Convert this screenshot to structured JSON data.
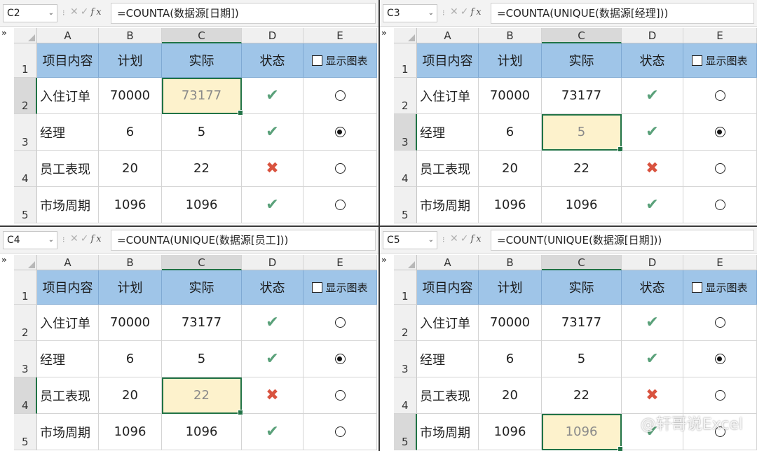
{
  "columns": [
    "A",
    "B",
    "C",
    "D",
    "E"
  ],
  "rows": [
    "1",
    "2",
    "3",
    "4",
    "5"
  ],
  "header": {
    "item": "项目内容",
    "plan": "计划",
    "actual": "实际",
    "status": "状态",
    "show_chart": "显示图表"
  },
  "data_rows": [
    {
      "item": "入住订单",
      "plan": "70000",
      "actual": "73177",
      "status": "check",
      "radio": false
    },
    {
      "item": "经理",
      "plan": "6",
      "actual": "5",
      "status": "check",
      "radio": true
    },
    {
      "item": "员工表现",
      "plan": "20",
      "actual": "22",
      "status": "cross",
      "radio": false
    },
    {
      "item": "市场周期",
      "plan": "1096",
      "actual": "1096",
      "status": "check",
      "radio": false
    }
  ],
  "panes": [
    {
      "cell_ref": "C2",
      "formula": "=COUNTA(数据源[日期])",
      "active_row": 2
    },
    {
      "cell_ref": "C3",
      "formula": "=COUNTA(UNIQUE(数据源[经理]))",
      "active_row": 3
    },
    {
      "cell_ref": "C4",
      "formula": "=COUNTA(UNIQUE(数据源[员工]))",
      "active_row": 4
    },
    {
      "cell_ref": "C5",
      "formula": "=COUNT(UNIQUE(数据源[日期]))",
      "active_row": 5
    }
  ],
  "glyphs": {
    "check": "✔",
    "cross": "✖",
    "collapse": "»",
    "chevron": "⌄",
    "cancel": "✕",
    "enter": "✓",
    "fx": "fx",
    "sep": "⁝"
  },
  "watermark": "@轩哥说Excel",
  "colors": {
    "header_fill": "#9fc5e8",
    "active_fill": "#fdf2cc",
    "select_border": "#217346",
    "check": "#5aa17a",
    "cross": "#d9533f"
  }
}
